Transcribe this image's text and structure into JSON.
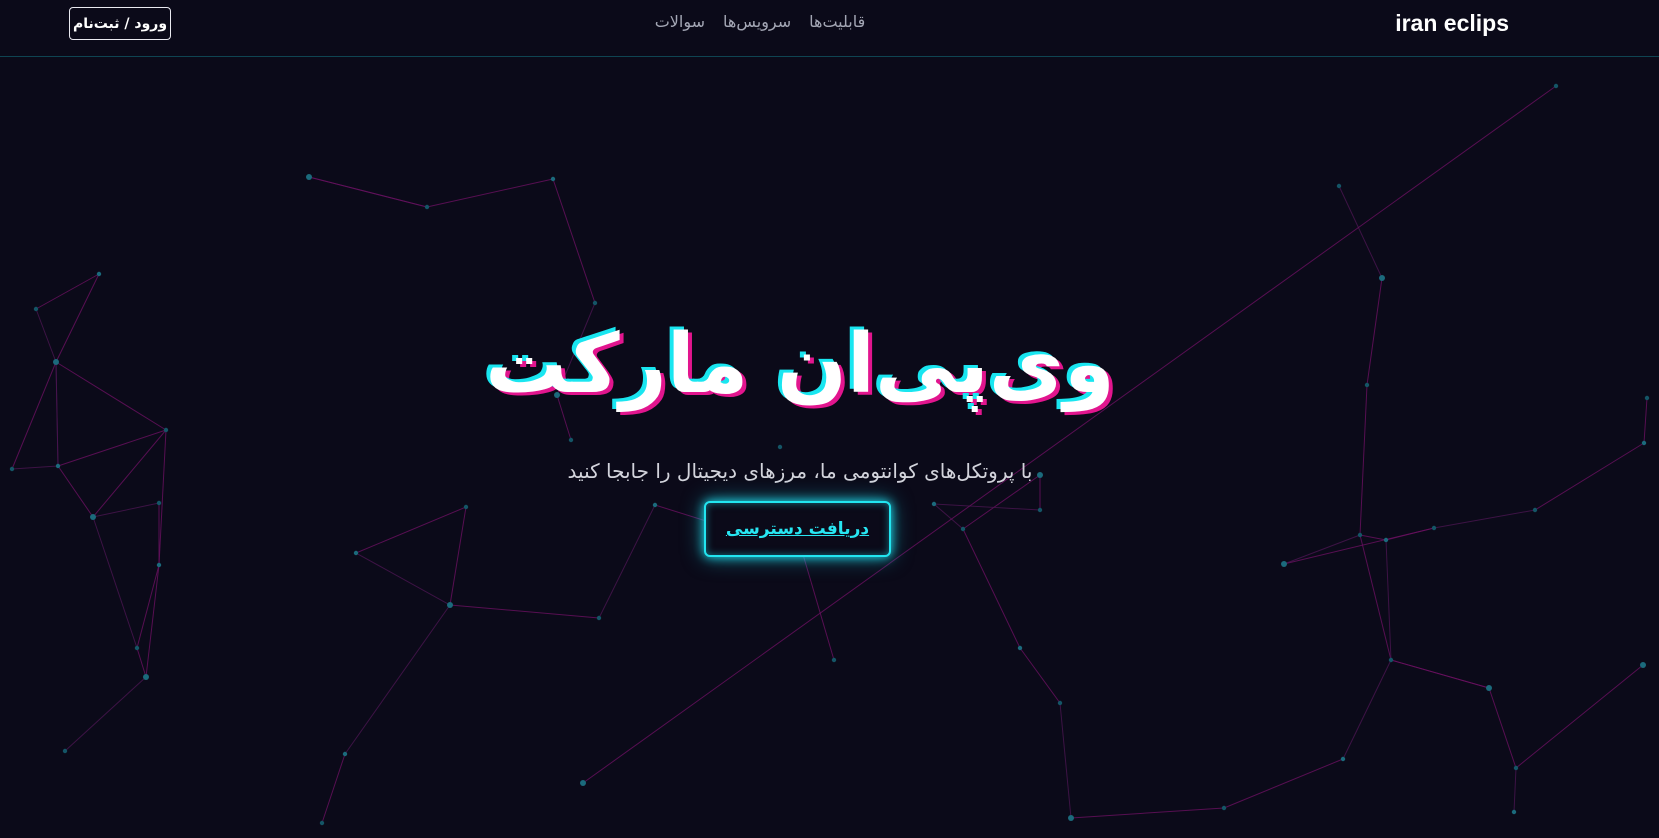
{
  "header": {
    "brand": "iran eclips",
    "nav": [
      {
        "label": "قابلیت‌ها"
      },
      {
        "label": "سرویس‌ها"
      },
      {
        "label": "سوالات"
      }
    ],
    "login_label": "ورود / ثبت‌نام"
  },
  "hero": {
    "title": "وی‌پی‌ان مارکت",
    "subtitle": "با پروتکل‌های کوانتومی ما، مرزهای دیجیتال را جابجا کنید",
    "cta_label": "دریافت دسترسی"
  },
  "theme": {
    "background": "#0b0a19",
    "accent_cyan": "#22e5f0",
    "accent_magenta": "#e2158e"
  }
}
